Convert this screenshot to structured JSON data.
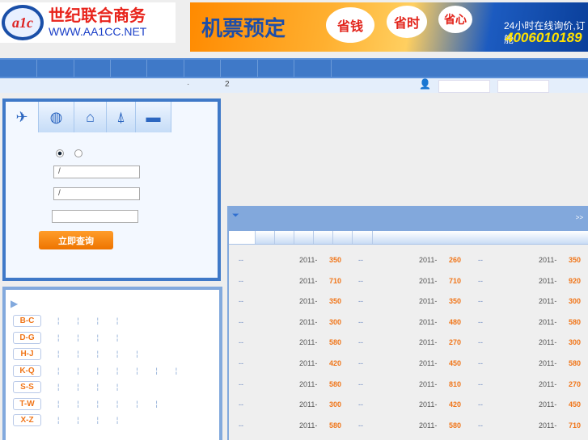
{
  "header": {
    "logo_mark": "a1c",
    "logo_title": "世纪联合商务",
    "logo_url": "WWW.AA1CC.NET",
    "banner": {
      "title": "机票预定",
      "bubbles": [
        "省钱",
        "省时",
        "省心"
      ],
      "slogan": "24小时在线询价,订舱",
      "phone": "4006010189"
    }
  },
  "subbar": {
    "dot": "·",
    "num": "2"
  },
  "search": {
    "tabs": [
      "plane-icon",
      "globe-icon",
      "home-icon",
      "tower-icon",
      "card-icon"
    ],
    "from_value": "/",
    "to_value": "/",
    "date_value": "",
    "button": "立即查询"
  },
  "cities": {
    "groups": [
      {
        "label": "B-C",
        "count": 4
      },
      {
        "label": "D-G",
        "count": 4
      },
      {
        "label": "H-J",
        "count": 5
      },
      {
        "label": "K-Q",
        "count": 7
      },
      {
        "label": "S-S",
        "count": 4
      },
      {
        "label": "T-W",
        "count": 6
      },
      {
        "label": "X-Z",
        "count": 4
      }
    ],
    "sep": "¦"
  },
  "deals": {
    "more": ">>",
    "dash": "--",
    "year": "2011-",
    "columns": [
      [
        "350",
        "710",
        "350",
        "300",
        "580",
        "420",
        "580",
        "300",
        "580"
      ],
      [
        "260",
        "710",
        "350",
        "480",
        "270",
        "450",
        "810",
        "420",
        "580"
      ],
      [
        "350",
        "920",
        "300",
        "580",
        "300",
        "580",
        "270",
        "450",
        "710"
      ]
    ]
  }
}
